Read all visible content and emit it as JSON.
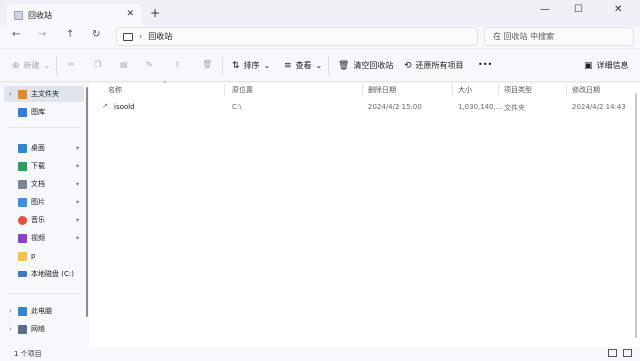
{
  "window": {
    "tab_title": "回收站",
    "close_tab_glyph": "✕",
    "new_tab_glyph": "+",
    "minimize_glyph": "—",
    "maximize_glyph": "☐",
    "close_glyph": "✕"
  },
  "address": {
    "back_glyph": "←",
    "forward_glyph": "→",
    "up_glyph": "↑",
    "refresh_glyph": "↻",
    "chevron_glyph": "›",
    "location": "回收站",
    "search_placeholder": "在 回收站 中搜索"
  },
  "commands": {
    "new_label": "新建",
    "sort_label": "排序",
    "view_label": "查看",
    "empty_bin_label": "清空回收站",
    "restore_all_label": "还原所有项目",
    "more_glyph": "•••",
    "details_label": "详细信息",
    "dropdown_glyph": "⌄"
  },
  "sidebar": {
    "items": [
      {
        "label": "主文件夹",
        "icon": "home-icon",
        "color": "#e08a2a"
      },
      {
        "label": "图库",
        "icon": "gallery-icon",
        "color": "#2f7ed8"
      },
      {
        "label": "桌面",
        "icon": "desktop-icon",
        "color": "#2f86d6"
      },
      {
        "label": "下载",
        "icon": "download-icon",
        "color": "#2aa05a"
      },
      {
        "label": "文档",
        "icon": "documents-icon",
        "color": "#7b8794"
      },
      {
        "label": "图片",
        "icon": "pictures-icon",
        "color": "#3a8ee6"
      },
      {
        "label": "音乐",
        "icon": "music-icon",
        "color": "#e0533a"
      },
      {
        "label": "视频",
        "icon": "videos-icon",
        "color": "#8a3fd1"
      },
      {
        "label": "p",
        "icon": "folder-icon",
        "color": "#f2c14e"
      },
      {
        "label": "本地磁盘 (C:)",
        "icon": "drive-icon",
        "color": "#3c7bbf"
      },
      {
        "label": "此电脑",
        "icon": "computer-icon",
        "color": "#2f86d6"
      },
      {
        "label": "网络",
        "icon": "network-icon",
        "color": "#5a6f8a"
      }
    ],
    "pin_glyph": "📌",
    "expand_glyph": "›"
  },
  "columns": [
    "名称",
    "原位置",
    "删除日期",
    "大小",
    "项目类型",
    "修改日期"
  ],
  "files": [
    {
      "name": "isoold",
      "original_location": "C:\\",
      "deleted_date": "2024/4/2 15:00",
      "size": "1,030,140,...",
      "type": "文件夹",
      "modified_date": "2024/4/2 14:43"
    }
  ],
  "status": {
    "item_count": "1 个项目"
  }
}
